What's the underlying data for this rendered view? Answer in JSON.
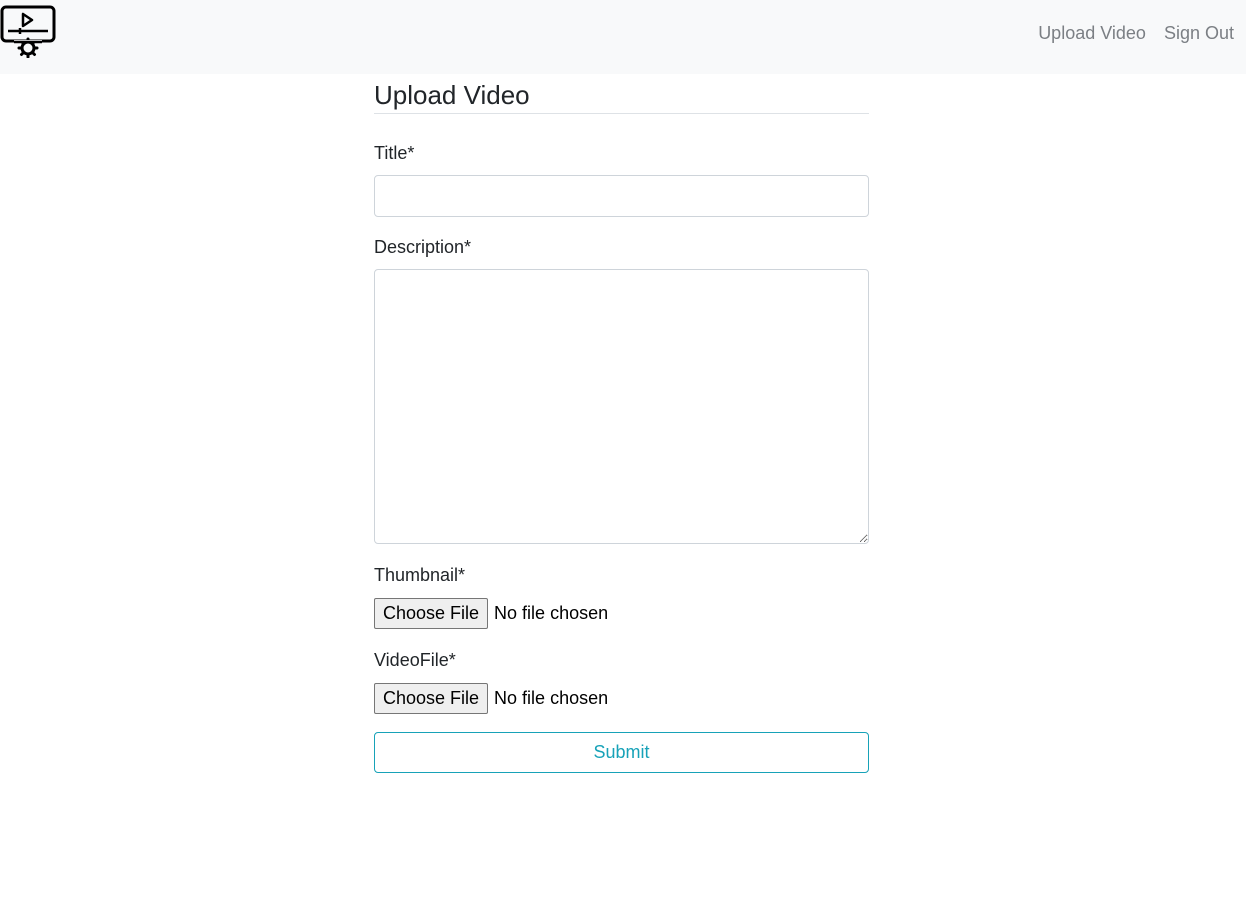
{
  "navbar": {
    "logo_icon": "video-settings-logo-icon",
    "links": [
      {
        "label": "Upload Video"
      },
      {
        "label": "Sign Out"
      }
    ]
  },
  "page": {
    "title": "Upload Video"
  },
  "form": {
    "title_label": "Title*",
    "title_value": "",
    "description_label": "Description*",
    "description_value": "",
    "thumbnail_label": "Thumbnail*",
    "thumbnail_button": "Choose File",
    "thumbnail_status": "No file chosen",
    "videofile_label": "VideoFile*",
    "videofile_button": "Choose File",
    "videofile_status": "No file chosen",
    "submit_label": "Submit"
  },
  "colors": {
    "navbar_bg": "#f8f9fa",
    "nav_link": "#7b7f84",
    "accent": "#17a2b8"
  }
}
